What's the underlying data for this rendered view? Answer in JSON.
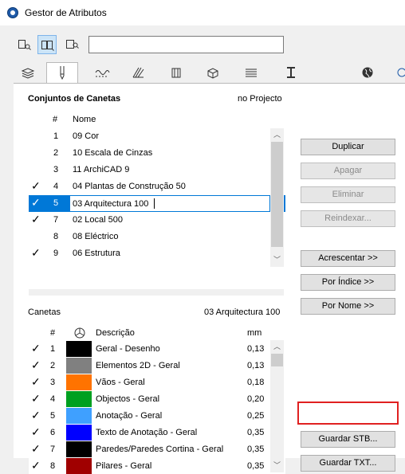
{
  "window": {
    "title": "Gestor de Atributos"
  },
  "filter": {
    "value": ""
  },
  "tabs": [
    {
      "icon": "layers-icon"
    },
    {
      "icon": "pen-icon"
    },
    {
      "icon": "line-type-icon"
    },
    {
      "icon": "fill-icon"
    },
    {
      "icon": "composite-icon"
    },
    {
      "icon": "material-icon"
    },
    {
      "icon": "zone-icon"
    },
    {
      "icon": "profile-icon"
    },
    {
      "icon": "globe-icon"
    }
  ],
  "pen_sets": {
    "header": "Conjuntos de Canetas",
    "location": "no Projecto",
    "col_num": "#",
    "col_name": "Nome",
    "edit_value": "03 Arquitectura 100",
    "rows": [
      {
        "check": "",
        "num": "1",
        "name": "09 Cor"
      },
      {
        "check": "",
        "num": "2",
        "name": "10 Escala de Cinzas"
      },
      {
        "check": "",
        "num": "3",
        "name": "11 ArchiCAD 9"
      },
      {
        "check": "✓",
        "num": "4",
        "name": "04 Plantas de Construção 50"
      },
      {
        "check": "✓",
        "num": "5",
        "name": "03 Arquitectura 100"
      },
      {
        "check": "✓",
        "num": "7",
        "name": "02 Local 500"
      },
      {
        "check": "",
        "num": "8",
        "name": "08 Eléctrico"
      },
      {
        "check": "✓",
        "num": "9",
        "name": "06 Estrutura"
      }
    ]
  },
  "pens": {
    "header": "Canetas",
    "set_name": "03 Arquitectura 100",
    "col_num": "#",
    "col_desc": "Descrição",
    "col_mm": "mm",
    "rows": [
      {
        "check": "✓",
        "num": "1",
        "color": "#000000",
        "desc": "Geral - Desenho",
        "mm": "0,13"
      },
      {
        "check": "✓",
        "num": "2",
        "color": "#808080",
        "desc": "Elementos 2D - Geral",
        "mm": "0,13"
      },
      {
        "check": "✓",
        "num": "3",
        "color": "#ff7300",
        "desc": "Vãos - Geral",
        "mm": "0,18"
      },
      {
        "check": "✓",
        "num": "4",
        "color": "#00a020",
        "desc": "Objectos - Geral",
        "mm": "0,20"
      },
      {
        "check": "✓",
        "num": "5",
        "color": "#3fa0ff",
        "desc": "Anotação - Geral",
        "mm": "0,25"
      },
      {
        "check": "✓",
        "num": "6",
        "color": "#0000ff",
        "desc": "Texto de Anotação - Geral",
        "mm": "0,35"
      },
      {
        "check": "✓",
        "num": "7",
        "color": "#000000",
        "desc": "Paredes/Paredes Cortina - Geral",
        "mm": "0,35"
      },
      {
        "check": "✓",
        "num": "8",
        "color": "#a00000",
        "desc": "Pilares - Geral",
        "mm": "0,35"
      }
    ]
  },
  "buttons": {
    "duplicar": "Duplicar",
    "apagar": "Apagar",
    "eliminar": "Eliminar",
    "reindexar": "Reindexar...",
    "acrescentar": "Acrescentar >>",
    "por_indice": "Por Índice >>",
    "por_nome": "Por Nome >>",
    "guardar_stb": "Guardar STB...",
    "guardar_txt": "Guardar TXT..."
  },
  "colors": {
    "selection": "#0078d7",
    "highlight_border": "#e02020"
  }
}
